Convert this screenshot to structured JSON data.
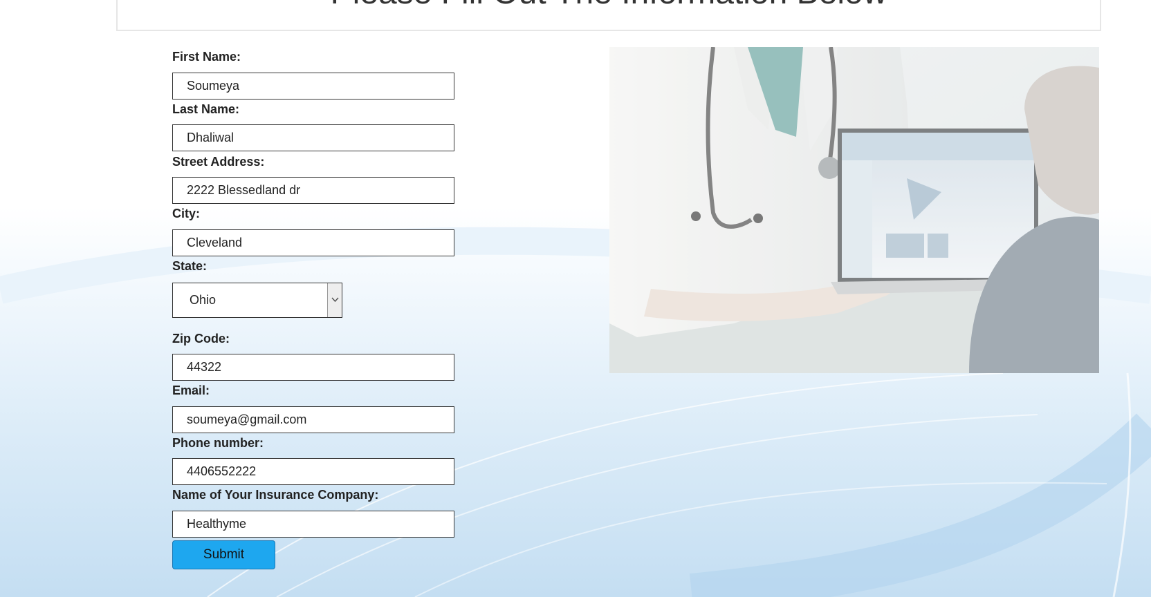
{
  "header": {
    "title": "Please Fill Out The Information Below"
  },
  "form": {
    "first_name": {
      "label": "First Name:",
      "value": "Soumeya"
    },
    "last_name": {
      "label": "Last Name:",
      "value": "Dhaliwal"
    },
    "street_address": {
      "label": "Street Address:",
      "value": "2222 Blessedland dr"
    },
    "city": {
      "label": "City:",
      "value": "Cleveland"
    },
    "state": {
      "label": "State:",
      "selected": "Ohio"
    },
    "zip": {
      "label": "Zip Code:",
      "value": "44322"
    },
    "email": {
      "label": "Email:",
      "value": "soumeya@gmail.com"
    },
    "phone": {
      "label": "Phone number:",
      "value": "4406552222"
    },
    "insurance": {
      "label": "Name of Your Insurance Company:",
      "value": "Healthyme"
    },
    "submit_label": "Submit"
  },
  "icons": {
    "select_arrow": "chevron-down-icon"
  },
  "colors": {
    "submit_button": "#1ea7ef",
    "background_accent": "#c4def2"
  }
}
